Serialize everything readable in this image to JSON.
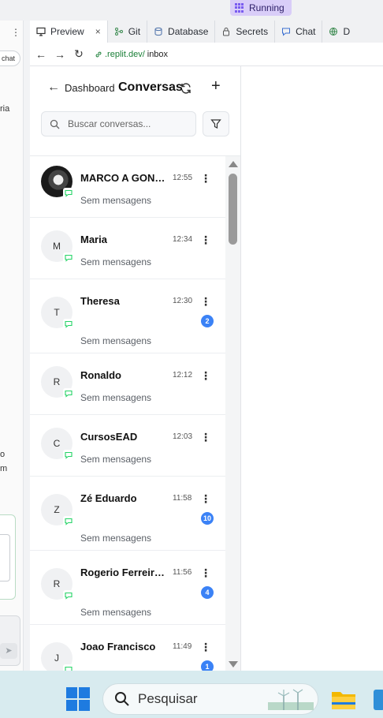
{
  "ide": {
    "run_status": "Running",
    "left_panel": {
      "pill_text": "chat",
      "fragments": [
        "ria",
        "o",
        "m"
      ],
      "send_icon": "send-icon"
    },
    "tabs": [
      {
        "label": "Preview",
        "icon": "monitor-icon",
        "active": true,
        "closable": true
      },
      {
        "label": "Git",
        "icon": "git-icon"
      },
      {
        "label": "Database",
        "icon": "database-icon"
      },
      {
        "label": "Secrets",
        "icon": "lock-icon"
      },
      {
        "label": "Chat",
        "icon": "chat-icon"
      },
      {
        "label": "D",
        "icon": "globe-icon"
      }
    ],
    "url_host": ".replit.dev/",
    "url_path": "inbox"
  },
  "app": {
    "back_label": "Dashboard",
    "title": "Conversas",
    "search_placeholder": "Buscar conversas...",
    "conversations": [
      {
        "initial": "",
        "has_photo": true,
        "name": "MARCO A GONC...",
        "time": "12:55",
        "preview": "Sem mensagens",
        "badge": null
      },
      {
        "initial": "M",
        "name": "Maria",
        "time": "12:34",
        "preview": "Sem mensagens",
        "badge": null
      },
      {
        "initial": "T",
        "name": "Theresa",
        "time": "12:30",
        "preview": "Sem mensagens",
        "badge": "2"
      },
      {
        "initial": "R",
        "name": "Ronaldo",
        "time": "12:12",
        "preview": "Sem mensagens",
        "badge": null
      },
      {
        "initial": "C",
        "name": "CursosEAD",
        "time": "12:03",
        "preview": "Sem mensagens",
        "badge": null
      },
      {
        "initial": "Z",
        "name": "Zé Eduardo",
        "time": "11:58",
        "preview": "Sem mensagens",
        "badge": "10"
      },
      {
        "initial": "R",
        "name": "Rogerio Ferreira🎻",
        "time": "11:56",
        "preview": "Sem mensagens",
        "badge": "4"
      },
      {
        "initial": "J",
        "name": "Joao Francisco",
        "time": "11:49",
        "preview": "",
        "badge": "1"
      }
    ]
  },
  "taskbar": {
    "search_label": "Pesquisar"
  },
  "colors": {
    "accent_badge": "#3b82f6",
    "running_bg": "#d9cdf8",
    "url_host": "#1a7f37",
    "whatsapp_green": "#25d366"
  }
}
